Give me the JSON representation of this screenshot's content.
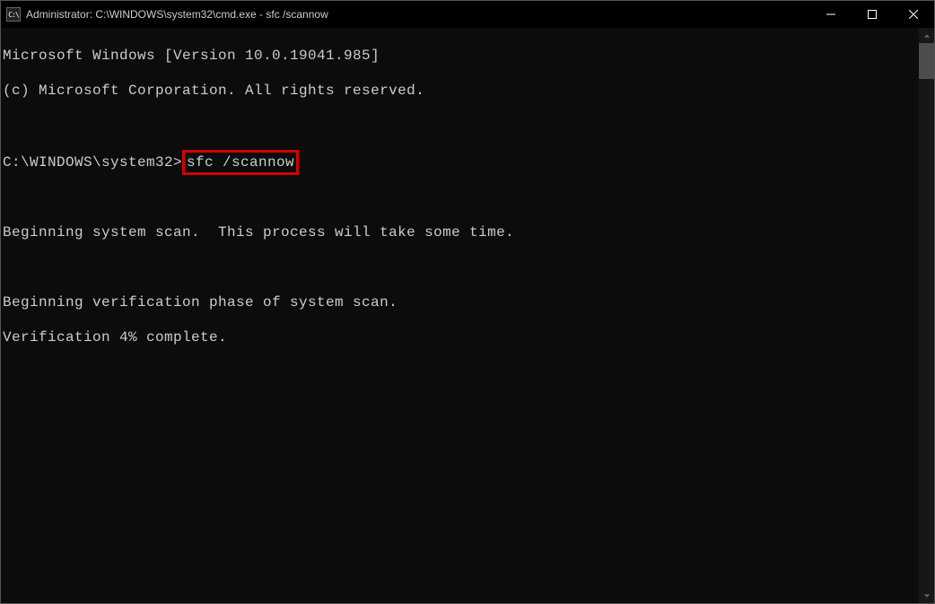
{
  "titlebar": {
    "icon_text": "C:\\",
    "title": "Administrator: C:\\WINDOWS\\system32\\cmd.exe - sfc  /scannow"
  },
  "terminal": {
    "line1": "Microsoft Windows [Version 10.0.19041.985]",
    "line2": "(c) Microsoft Corporation. All rights reserved.",
    "prompt_path": "C:\\WINDOWS\\system32>",
    "command": "sfc /scannow",
    "line_scan": "Beginning system scan.  This process will take some time.",
    "line_verif": "Beginning verification phase of system scan.",
    "line_progress": "Verification 4% complete."
  }
}
